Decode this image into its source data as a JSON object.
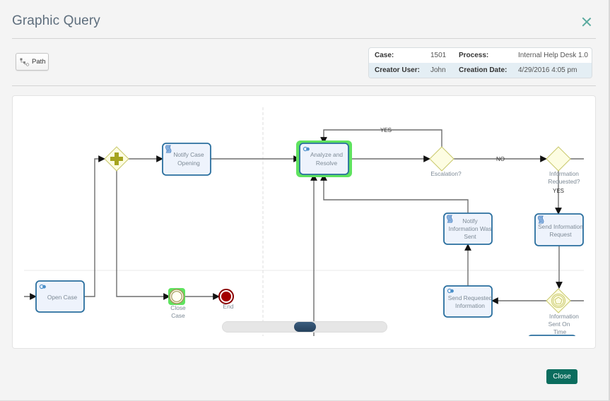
{
  "dialog": {
    "title": "Graphic Query",
    "close_icon": "close-x-icon",
    "close_button_label": "Close"
  },
  "toolbar": {
    "path_button": {
      "label": "Path",
      "icon": "path-nodes-icon"
    }
  },
  "case_info": {
    "rows": [
      [
        {
          "label": "Case:",
          "value": "1501"
        },
        {
          "label": "Process:",
          "value": "Internal Help Desk 1.0"
        }
      ],
      [
        {
          "label": "Creator User:",
          "value": "John"
        },
        {
          "label": "Creation Date:",
          "value": "4/29/2016 4:05 pm"
        }
      ]
    ]
  },
  "diagram": {
    "tasks": {
      "open_case": {
        "lines": [
          "Open Case"
        ],
        "icon": "service-task-icon"
      },
      "notify_case_opening": {
        "lines": [
          "Notify Case",
          "Opening"
        ],
        "icon": "script-task-icon"
      },
      "analyze_and_resolve": {
        "lines": [
          "Analyze and",
          "Resolve"
        ],
        "icon": "service-task-icon",
        "highlighted": true
      },
      "notify_information_was_sent": {
        "lines": [
          "Notify",
          "Information Was",
          "Sent"
        ],
        "icon": "script-task-icon"
      },
      "send_information_request": {
        "lines": [
          "Send Information",
          "Request"
        ],
        "icon": "script-task-icon"
      },
      "send_requested_information": {
        "lines": [
          "Send Requested",
          "Information"
        ],
        "icon": "service-task-icon"
      }
    },
    "events": {
      "close_case": {
        "lines": [
          "Close",
          "Case"
        ],
        "type": "intermediate",
        "highlighted": true
      },
      "end": {
        "lines": [
          "End"
        ],
        "type": "end"
      }
    },
    "gateways": {
      "parallel": {
        "type": "parallel",
        "icon": "plus-icon"
      },
      "escalation": {
        "lines": [
          "Escalation?"
        ],
        "type": "exclusive"
      },
      "information_requested": {
        "lines": [
          "Information",
          "Requested?"
        ],
        "type": "exclusive"
      },
      "information_sent_on_time": {
        "lines": [
          "Information",
          "Sent On",
          "Time"
        ],
        "type": "event-based",
        "icon": "pentagon-event-icon"
      }
    },
    "edge_labels": {
      "escalation_yes": "YES",
      "escalation_no": "NO",
      "information_requested_yes": "YES"
    },
    "horizontal_scroll": {
      "position": 0.5
    }
  },
  "colors": {
    "accent": "#0b6d5e",
    "close_x": "#5aaa9f",
    "highlight": "#5fe35f",
    "task_border": "#2a6f9e",
    "task_fill": "#eef3fc",
    "gateway_fill": "#fdfde2",
    "gateway_stroke": "#c9c86c",
    "end_event": "#a30000"
  }
}
